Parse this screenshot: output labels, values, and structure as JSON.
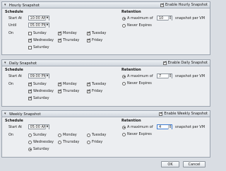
{
  "panels": [
    {
      "title": "Hourly Snapshot",
      "enable_label": "Enable Hourly Snapshot",
      "schedule_title": "Schedule",
      "start_label": "Start At",
      "start_value": "10:00 AM",
      "until_label": "Until",
      "until_value": "05:00 PM",
      "on_label": "On",
      "days": [
        {
          "label": "Sunday",
          "checked": false
        },
        {
          "label": "Monday",
          "checked": true
        },
        {
          "label": "Tuesday",
          "checked": true
        },
        {
          "label": "Wednesday",
          "checked": true
        },
        {
          "label": "Thursday",
          "checked": true
        },
        {
          "label": "Friday",
          "checked": true
        },
        {
          "label": "Saturday",
          "checked": false
        }
      ],
      "day_control": "checkbox",
      "retention_title": "Retention",
      "max_label": "A maximum of",
      "max_value": "10",
      "per_label": "snapshot per VM",
      "never_label": "Never Expires",
      "retention_choice": "max",
      "focused": false
    },
    {
      "title": "Daily Snapshot",
      "enable_label": "Enable Daily Snapshot",
      "schedule_title": "Schedule",
      "start_label": "Start At",
      "start_value": "09:00 PM",
      "on_label": "On",
      "days": [
        {
          "label": "Sunday",
          "checked": true
        },
        {
          "label": "Monday",
          "checked": true
        },
        {
          "label": "Tuesday",
          "checked": true
        },
        {
          "label": "Wednesday",
          "checked": true
        },
        {
          "label": "Thursday",
          "checked": true
        },
        {
          "label": "Friday",
          "checked": true
        },
        {
          "label": "Saturday",
          "checked": true
        }
      ],
      "day_control": "checkbox",
      "retention_title": "Retention",
      "max_label": "A maximum of",
      "max_value": "7",
      "per_label": "snapshot per VM",
      "never_label": "Never Expires",
      "retention_choice": "max",
      "focused": false
    },
    {
      "title": "Weekly Snapshot",
      "enable_label": "Enable Weekly Snapshot",
      "schedule_title": "Schedule",
      "start_label": "Start At",
      "start_value": "05:00 AM",
      "on_label": "On",
      "days": [
        {
          "label": "Sunday",
          "checked": false
        },
        {
          "label": "Monday",
          "checked": false
        },
        {
          "label": "Tuesday",
          "checked": false
        },
        {
          "label": "Wednesday",
          "checked": false
        },
        {
          "label": "Thursday",
          "checked": false
        },
        {
          "label": "Friday",
          "checked": false
        },
        {
          "label": "Saturday",
          "checked": true
        }
      ],
      "day_control": "radio",
      "retention_title": "Retention",
      "max_label": "A maximum of",
      "max_value": "4",
      "per_label": "snapshot per VM",
      "never_label": "Never Expires",
      "retention_choice": "max",
      "focused": true
    }
  ],
  "footer": {
    "ok_label": "OK",
    "cancel_label": "Cancel"
  },
  "colors": {
    "background": "#d9dde3",
    "panel": "#eceef1",
    "focus": "#3c7bd2"
  }
}
